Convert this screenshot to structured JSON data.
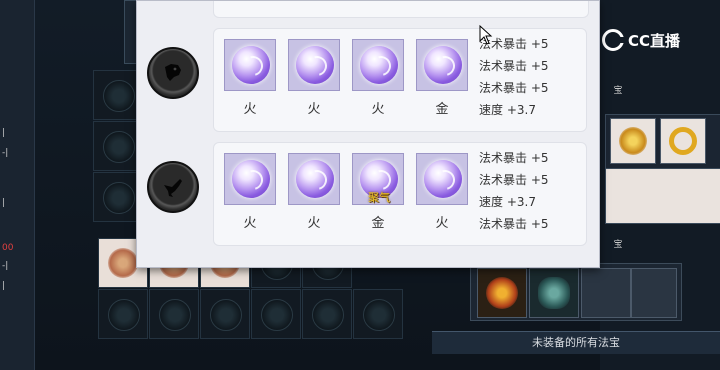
{
  "left_strip": {
    "marks": [
      "|",
      "-|",
      "|",
      "00",
      "-|",
      "|"
    ]
  },
  "logo": {
    "text": "CC直播"
  },
  "right_panel": {
    "section_label_1": "宝",
    "section_label_2": "宝",
    "footer_label": "未装备的所有法宝"
  },
  "popup": {
    "rows": [
      {
        "avatar_icon": "dark-beast-head-icon",
        "gems": [
          {
            "element": "火",
            "tag": ""
          },
          {
            "element": "火",
            "tag": ""
          },
          {
            "element": "火",
            "tag": ""
          },
          {
            "element": "金",
            "tag": ""
          }
        ],
        "stats": [
          "法术暴击 +5",
          "法术暴击 +5",
          "法术暴击 +5",
          "速度 +3.7"
        ]
      },
      {
        "avatar_icon": "dark-bird-icon",
        "gems": [
          {
            "element": "火",
            "tag": ""
          },
          {
            "element": "火",
            "tag": ""
          },
          {
            "element": "金",
            "tag": "聚气"
          },
          {
            "element": "火",
            "tag": ""
          }
        ],
        "stats": [
          "法术暴击 +5",
          "法术暴击 +5",
          "速度 +3.7",
          "法术暴击 +5"
        ]
      }
    ]
  },
  "colors": {
    "gem_accent": "#b896f0",
    "tag_gold": "#f0c420",
    "popup_bg": "#edeef3"
  }
}
